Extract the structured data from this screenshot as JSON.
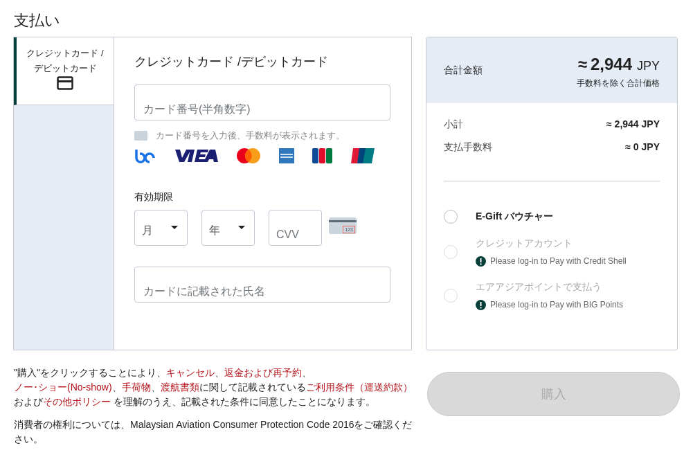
{
  "page_title": "支払い",
  "method_tabs": [
    {
      "label": "クレジットカード /デビットカード",
      "selected": true
    }
  ],
  "card_form": {
    "heading": "クレジットカード /デビットカード",
    "card_number": {
      "placeholder": "カード番号(半角数字)"
    },
    "fee_hint": "カード番号を入力後、手数料が表示されます。",
    "expiry_label": "有効期限",
    "month": {
      "placeholder": "月"
    },
    "year": {
      "placeholder": "年"
    },
    "cvv": {
      "placeholder": "CVV"
    },
    "cvv_card_digits": "123",
    "name": {
      "placeholder": "カードに記載された氏名"
    }
  },
  "summary": {
    "total_label": "合計金額",
    "total_approx": "≈",
    "total_amount": "2,944",
    "total_currency": "JPY",
    "total_note": "手数料を除く合計価格",
    "lines": [
      {
        "label": "小計",
        "value": "≈ 2,944 JPY"
      },
      {
        "label": "支払手数料",
        "value": "≈ 0 JPY"
      }
    ]
  },
  "other_payments": [
    {
      "label": "E-Gift バウチャー",
      "selected": false,
      "disabled": false
    },
    {
      "label": "クレジットアカウント",
      "selected": false,
      "disabled": true,
      "note": "Please log-in to Pay with Credit Shell"
    },
    {
      "label": "エアアジアポイントで支払う",
      "selected": false,
      "disabled": true,
      "note": "Please log-in to Pay with BIG Points"
    }
  ],
  "terms": [
    {
      "kind": "text",
      "text": "\"購入\"をクリックすることにより、"
    },
    {
      "kind": "link",
      "text": "キャンセル"
    },
    {
      "kind": "text",
      "text": "、"
    },
    {
      "kind": "link",
      "text": "返金および再予約"
    },
    {
      "kind": "text",
      "text": "、"
    },
    {
      "kind": "link",
      "text": "ノー･ショー(No-show)"
    },
    {
      "kind": "text",
      "text": "、"
    },
    {
      "kind": "link",
      "text": "手荷物"
    },
    {
      "kind": "text",
      "text": "、"
    },
    {
      "kind": "link",
      "text": "渡航書類"
    },
    {
      "kind": "text",
      "text": "に関して記載されている"
    },
    {
      "kind": "link",
      "text": "ご利用条件（運送約款）"
    },
    {
      "kind": "text",
      "text": "および"
    },
    {
      "kind": "link",
      "text": "その他ポリシー"
    },
    {
      "kind": "text",
      "text": " を理解のうえ、記載された条件に同意したことになります。"
    }
  ],
  "consumer_note": "消費者の権利については、Malaysian Aviation Consumer Protection Code 2016をご確認ください。",
  "purchase_button": {
    "label": "購入",
    "disabled": true
  }
}
